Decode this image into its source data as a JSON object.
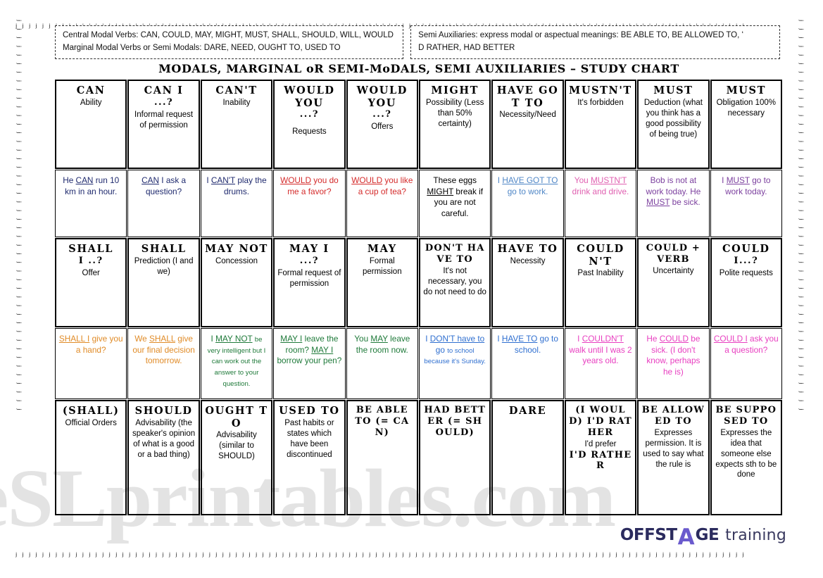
{
  "border": {
    "glyph": "ⱼ"
  },
  "watermark": {
    "line1": "eSLprintables.com",
    "line2": ""
  },
  "info": {
    "left": [
      "Central Modal Verbs: CAN, COULD, MAY, MIGHT, MUST, SHALL, SHOULD, WILL, WOULD",
      "Marginal Modal Verbs or Semi Modals: DARE, NEED, OUGHT TO, USED TO"
    ],
    "right": [
      "Semi Auxiliaries: express modal or aspectual meanings: BE ABLE TO, BE ALLOWED TO, ʻ",
      "D RATHER, HAD BETTER"
    ]
  },
  "title": "MODALS, MARGINAL oR SEMI-MoDALS, SEMI AUXILIARIES – STUDY CHART",
  "logo": {
    "part1": "OFF",
    "part2": "ST",
    "letter_a": "A",
    "part3": "GE",
    "word": "training"
  },
  "colors": {
    "navy": "#1f2a6e",
    "red": "#d42a2a",
    "black": "#000000",
    "lightblue": "#4f86c6",
    "pink": "#e05fb0",
    "purple": "#7b3f9e",
    "orange": "#e08b27",
    "green": "#1f7a3a",
    "blue": "#2f6fd0",
    "magenta": "#e83ec0"
  },
  "rows": [
    {
      "type": "header",
      "cells": [
        {
          "headword": "CAN",
          "q": "",
          "desc": "Ability"
        },
        {
          "headword": "CAN I",
          "q": "...?",
          "desc": "Informal request of permission"
        },
        {
          "headword": "CAN'T",
          "q": "",
          "desc": "Inability"
        },
        {
          "headword": "WOULD YOU",
          "q": "...?",
          "desc": "Requests",
          "gap": true
        },
        {
          "headword": "WOULD YOU",
          "q": "...?",
          "desc": "Offers"
        },
        {
          "headword": "MIGHT",
          "q": "",
          "desc": "Possibility (Less than 50% certainty)"
        },
        {
          "headword": "HAVE GOT TO",
          "q": "",
          "desc": "Necessity/Need"
        },
        {
          "headword": "MUSTN'T",
          "q": "",
          "desc": "It's forbidden"
        },
        {
          "headword": "MUST",
          "q": "",
          "desc": "Deduction (what you think has a good possibility of being true)"
        },
        {
          "headword": "MUST",
          "q": "",
          "desc": "Obligation 100% necessary"
        }
      ]
    },
    {
      "type": "example",
      "cells": [
        {
          "color": "navy",
          "html": "He <u>CAN</u> run 10 km in an hour."
        },
        {
          "color": "navy",
          "html": "<u>CAN</u> I ask a question?"
        },
        {
          "color": "navy",
          "html": "I <u>CAN'T</u> play the drums."
        },
        {
          "color": "red",
          "html": "<u>WOULD</u> you do me a favor?"
        },
        {
          "color": "red",
          "html": "<u>WOULD</u> you like a cup of tea?"
        },
        {
          "color": "black",
          "html": "These eggs <u>MIGHT</u> break if you are not careful."
        },
        {
          "color": "lightblue",
          "html": "I <u>HAVE GOT TO</u> go to work."
        },
        {
          "color": "pink",
          "html": "You <u>MUSTN'T</u> drink and drive."
        },
        {
          "color": "purple",
          "html": "Bob is not at work today. He <u>MUST</u> be sick."
        },
        {
          "color": "purple",
          "html": "I <u>MUST</u> go to work today."
        }
      ]
    },
    {
      "type": "header",
      "cells": [
        {
          "headword": "SHALL",
          "q": "I ..?",
          "desc": "Offer"
        },
        {
          "headword": "SHALL",
          "q": "",
          "desc": "Prediction (I and we)"
        },
        {
          "headword": "MAY NOT",
          "q": "",
          "desc": "Concession"
        },
        {
          "headword": "MAY I",
          "q": "...?",
          "desc": "Formal request of permission"
        },
        {
          "headword": "MAY",
          "q": "",
          "desc": "Formal permission"
        },
        {
          "headword": "DON'T HAVE TO",
          "q": "",
          "desc": "It's not necessary, you do not need to do"
        },
        {
          "headword": "HAVE TO",
          "q": "",
          "desc": "Necessity"
        },
        {
          "headword": "COULDN'T",
          "q": "",
          "desc": "Past Inability"
        },
        {
          "headword": "COULD + VERB",
          "q": "",
          "desc": "Uncertainty"
        },
        {
          "headword": "COULD",
          "q": "I...?",
          "desc": "Polite requests"
        }
      ]
    },
    {
      "type": "example",
      "cells": [
        {
          "color": "orange",
          "html": "<u>SHALL I</u> give you a hand?"
        },
        {
          "color": "orange",
          "html": "We <u>SHALL</u> give our final decision tomorrow."
        },
        {
          "color": "green",
          "html": "I <u>MAY NOT</u> <span class='sm'>be very intelligent but I can work out the answer to your question.</span>"
        },
        {
          "color": "green",
          "html": "<u>MAY I</u> leave the room? <u>MAY I</u> borrow your pen?"
        },
        {
          "color": "green",
          "html": "You <u>MAY</u> leave the room now."
        },
        {
          "color": "blue",
          "html": "I <u>DON'T have to</u> go <span class='sm'>to school because it's Sunday.</span>"
        },
        {
          "color": "blue",
          "html": "I <u>HAVE TO</u> go to school."
        },
        {
          "color": "magenta",
          "html": "I <u>COULDN'T</u> walk until I was 2 years old."
        },
        {
          "color": "magenta",
          "html": "He <u>COULD</u> be sick. (I don't know, perhaps he is)"
        },
        {
          "color": "magenta",
          "html": "<u>COULD I</u> ask you a question?"
        }
      ]
    },
    {
      "type": "header",
      "cells": [
        {
          "headword": "(SHALL)",
          "q": "",
          "desc": "Official Orders"
        },
        {
          "headword": "SHOULD",
          "q": "",
          "desc": "Advisability (the speaker's opinion of what is a good or a bad thing)"
        },
        {
          "headword": "OUGHT TO",
          "q": "",
          "desc": "Advisability (similar to SHOULD)"
        },
        {
          "headword": "USED TO",
          "q": "",
          "desc": "Past habits or states which have been discontinued"
        },
        {
          "headword": "BE ABLE TO (= CAN)",
          "q": "",
          "desc": ""
        },
        {
          "headword": "HAD BETTER (= SHOULD)",
          "q": "",
          "desc": ""
        },
        {
          "headword": "DARE",
          "q": "",
          "desc": ""
        },
        {
          "headword": "(I WOULD) I'D RATHER",
          "q": "",
          "desc": "I'd prefer",
          "desc_after": "I'D RATHER"
        },
        {
          "headword": "BE ALLOWED TO",
          "q": "",
          "desc": "Expresses permission. It is used to say what the rule is"
        },
        {
          "headword": "BE SUPPOSED TO",
          "q": "",
          "desc": "Expresses the idea that someone else expects sth to be done"
        }
      ]
    }
  ]
}
